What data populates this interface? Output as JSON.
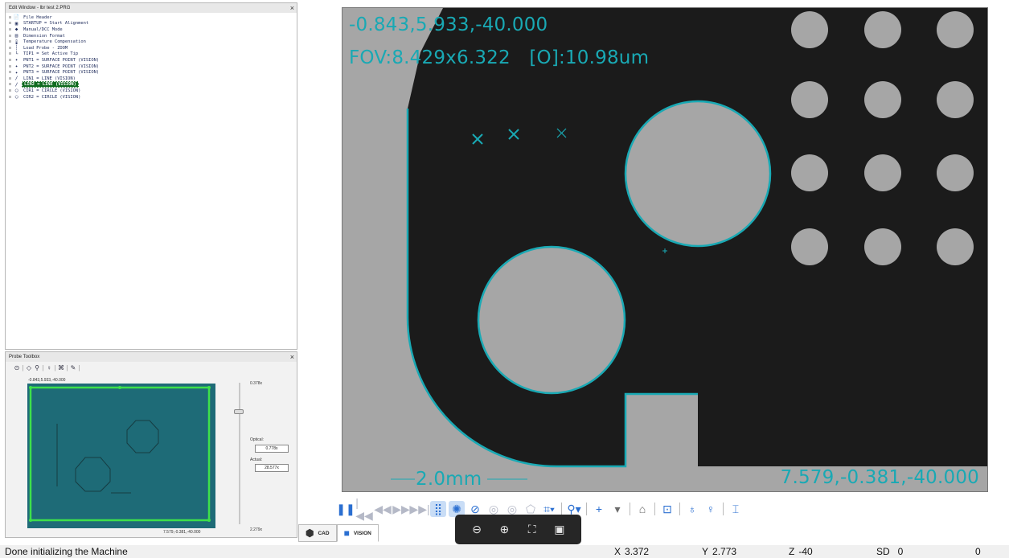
{
  "edit_window": {
    "title": "Edit Window - lbr test 2.PRG",
    "close": "×",
    "items": [
      {
        "icon": "📄",
        "icon_name": "file-header-icon",
        "label": "File Header",
        "selected": false
      },
      {
        "icon": "▣",
        "icon_name": "startup-icon",
        "label": "STARTUP = Start Alignment",
        "selected": false
      },
      {
        "icon": "◆",
        "icon_name": "manual-dcc-icon",
        "label": "Manual/DCC Mode",
        "selected": false
      },
      {
        "icon": "▤",
        "icon_name": "dimension-format-icon",
        "label": "Dimension Format",
        "selected": false
      },
      {
        "icon": "🌡",
        "icon_name": "temperature-icon",
        "label": "Temperature Compensation",
        "selected": false
      },
      {
        "icon": "┆",
        "icon_name": "load-probe-icon",
        "label": "Load Probe - ZOOM",
        "selected": false
      },
      {
        "icon": "└",
        "icon_name": "active-tip-icon",
        "label": "TIP1 = Set Active Tip",
        "selected": false
      },
      {
        "icon": "✦",
        "icon_name": "point-icon",
        "label": "PNT1 = SURFACE POINT (VISION)",
        "selected": false
      },
      {
        "icon": "✦",
        "icon_name": "point-icon",
        "label": "PNT2 = SURFACE POINT (VISION)",
        "selected": false
      },
      {
        "icon": "✦",
        "icon_name": "point-icon",
        "label": "PNT3 = SURFACE POINT (VISION)",
        "selected": false
      },
      {
        "icon": "∕",
        "icon_name": "line-icon",
        "label": "LIN1 = LINE (VISION)",
        "selected": false
      },
      {
        "icon": "∕",
        "icon_name": "line-icon",
        "label": "LIN2 = LINE (VISION)",
        "selected": true
      },
      {
        "icon": "◯",
        "icon_name": "circle-icon",
        "label": "CIR1 = CIRCLE (VISION)",
        "selected": false
      },
      {
        "icon": "◯",
        "icon_name": "circle-icon",
        "label": "CIR2 = CIRCLE (VISION)",
        "selected": false
      }
    ]
  },
  "probe_toolbox": {
    "title": "Probe Toolbox",
    "close": "×",
    "tool_icons": [
      "⊙",
      "|",
      "◇",
      "⚲",
      "|",
      "♀",
      "|",
      "⌘",
      "|",
      "✎",
      "|"
    ],
    "top_coord": "-0.843,5.933,-40.000",
    "bottom_coord": "7.579,-0.381,-40.000",
    "zoom_max": "0.378x",
    "zoom_min": "2.279x",
    "optical_label": "Optical:",
    "optical_value": "0.778x",
    "actual_label": "Actual:",
    "actual_value": "28.577x"
  },
  "vision": {
    "coords_top": "-0.843,5.933,-40.000",
    "fov": "FOV:8.429x6.322",
    "pixel": "[O]:10.98um",
    "scale": "2.0mm",
    "coords_bottom": "7.579,-0.381,-40.000",
    "accent_color": "#19a9b4"
  },
  "toolbar": {
    "buttons": [
      {
        "icon": "❚❚",
        "name": "pause-button",
        "style": "",
        "sep": false
      },
      {
        "icon": "|◀◀",
        "name": "first-button",
        "style": "dim",
        "sep": false
      },
      {
        "icon": "◀◀",
        "name": "rewind-button",
        "style": "dim",
        "sep": false
      },
      {
        "icon": "▶▶",
        "name": "forward-button",
        "style": "dim",
        "sep": false
      },
      {
        "icon": "▶▶|",
        "name": "last-button",
        "style": "dim",
        "sep": false
      },
      {
        "icon": "⣿",
        "name": "grid-button",
        "style": "on",
        "sep": false
      },
      {
        "icon": "✺",
        "name": "target-button",
        "style": "on",
        "sep": false
      },
      {
        "icon": "⊘",
        "name": "compass-button",
        "style": "",
        "sep": false
      },
      {
        "icon": "◎",
        "name": "ring-button",
        "style": "dim",
        "sep": false
      },
      {
        "icon": "◎",
        "name": "ring2-button",
        "style": "dim",
        "sep": false
      },
      {
        "icon": "⬠",
        "name": "shape-button",
        "style": "dim",
        "sep": false
      },
      {
        "icon": "⌗▾",
        "name": "crosshair-button",
        "style": "",
        "sep": true
      },
      {
        "icon": "⚲▾",
        "name": "zoom-button",
        "style": "",
        "sep": true
      },
      {
        "icon": "+",
        "name": "add-button",
        "style": "",
        "sep": false
      },
      {
        "icon": "▾",
        "name": "add-dropdown-button",
        "style": "dark",
        "sep": true
      },
      {
        "icon": "⌂",
        "name": "profile-button",
        "style": "dark",
        "sep": true
      },
      {
        "icon": "⊡",
        "name": "focus-button",
        "style": "",
        "sep": true
      },
      {
        "icon": "♁",
        "name": "light-add-button",
        "style": "",
        "sep": false
      },
      {
        "icon": "♀",
        "name": "light-button",
        "style": "",
        "sep": true
      },
      {
        "icon": "⌶",
        "name": "text-button",
        "style": "",
        "sep": false
      }
    ]
  },
  "tabs": [
    {
      "label": "CAD",
      "icon": "⬢",
      "active": false
    },
    {
      "label": "VISION",
      "icon": "■",
      "active": true
    }
  ],
  "zoom_popup": [
    "⊖",
    "⊕",
    "⛶",
    "▣"
  ],
  "status": {
    "message": "Done initializing the Machine",
    "x_label": "X",
    "x_value": "3.372",
    "y_label": "Y",
    "y_value": "2.773",
    "z_label": "Z",
    "z_value": "-40",
    "sd_label": "SD",
    "sd_value": "0",
    "extra_value": "0"
  }
}
